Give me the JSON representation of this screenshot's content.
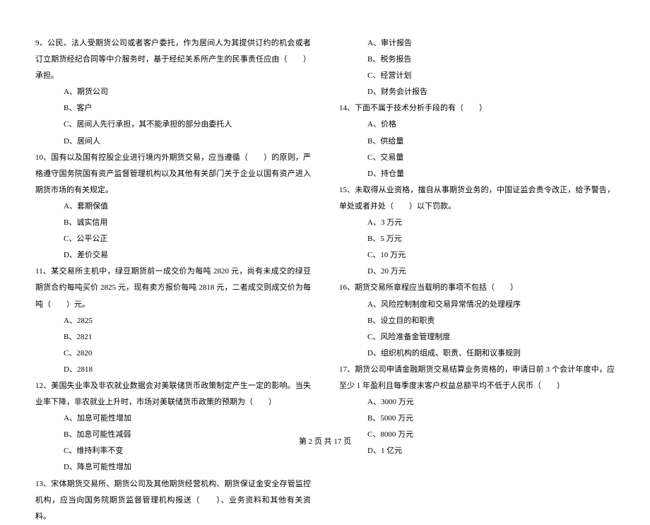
{
  "leftColumn": {
    "q9": {
      "text": "9、公民、法人受期货公司或者客户委托，作为居间人为其提供订约的机会或者订立期货经纪合同等中介服务时，基于经纪关系所产生的民事责任应由（　　）承担。",
      "optA": "A、期货公司",
      "optB": "B、客户",
      "optC": "C、居间人先行承担，其不能承担的部分由委托人",
      "optD": "D、居间人"
    },
    "q10": {
      "text": "10、国有以及国有控股企业进行境内外期货交易，应当遵循（　　）的原则，严格遵守国务院国有资产监督管理机构以及其他有关部门关于企业以国有资产进入期货市场的有关规定。",
      "optA": "A、套期保值",
      "optB": "B、诚实信用",
      "optC": "C、公平公正",
      "optD": "D、差价交易"
    },
    "q11": {
      "text": "11、某交易所主机中，绿豆期货前一成交价为每吨 2820 元，尚有未成交的绿豆期货合约每吨买价 2825 元，现有卖方报价每吨 2818 元，二者成交则成交价为每吨（　　）元。",
      "optA": "A、2825",
      "optB": "B、2821",
      "optC": "C、2820",
      "optD": "D、2818"
    },
    "q12": {
      "text": "12、美国失业率及非农就业数据会对美联储货币政策制定产生一定的影响。当失业率下降，非农就业上升时，市场对美联储货币政策的预期为（　　）",
      "optA": "A、加息可能性增加",
      "optB": "B、加息可能性减弱",
      "optC": "C、维持利率不变",
      "optD": "D、降息可能性增加"
    },
    "q13": {
      "text": "13、宋体期货交易所、期货公司及其他期货经营机构、期货保证金安全存管监控机构，应当向国务院期货监督管理机构报送（　　）、业务资料和其他有关资料。"
    }
  },
  "rightColumn": {
    "q13opts": {
      "optA": "A、审计报告",
      "optB": "B、税务报告",
      "optC": "C、经营计划",
      "optD": "D、财务会计报告"
    },
    "q14": {
      "text": "14、下面不属于技术分析手段的有（　　）",
      "optA": "A、价格",
      "optB": "B、供给量",
      "optC": "C、交易量",
      "optD": "D、持仓量"
    },
    "q15": {
      "text": "15、未取得从业资格，擅自从事期货业务的，中国证监会责令改正，给予警告，单处或者并处（　　）以下罚款。",
      "optA": "A、3 万元",
      "optB": "B、5 万元",
      "optC": "C、10 万元",
      "optD": "D、20 万元"
    },
    "q16": {
      "text": "16、期货交易所章程应当载明的事项不包括（　　）",
      "optA": "A、风险控制制度和交易异常情况的处理程序",
      "optB": "B、设立目的和职责",
      "optC": "C、风险准备金管理制度",
      "optD": "D、组织机构的组成、职责、任期和议事规则"
    },
    "q17": {
      "text": "17、期货公司申请金融期货交易结算业务资格的，申请日前 3 个会计年度中，应至少 1 年盈利且每季度末客户权益总额平均不低于人民币（　　）",
      "optA": "A、3000 万元",
      "optB": "B、5000 万元",
      "optC": "C、8000 万元",
      "optD": "D、1 亿元"
    }
  },
  "footer": "第 2 页 共 17 页"
}
